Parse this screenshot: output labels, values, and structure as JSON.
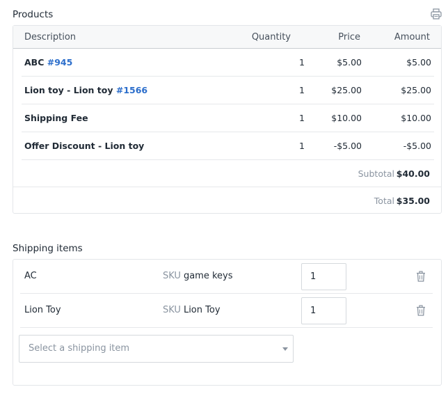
{
  "products": {
    "title": "Products",
    "print_icon": "printer-icon",
    "columns": {
      "description": "Description",
      "quantity": "Quantity",
      "price": "Price",
      "amount": "Amount"
    },
    "rows": [
      {
        "name": "ABC",
        "link": "#945",
        "quantity": "1",
        "price": "$5.00",
        "amount": "$5.00"
      },
      {
        "name": "Lion toy - Lion toy",
        "link": "#1566",
        "quantity": "1",
        "price": "$25.00",
        "amount": "$25.00"
      },
      {
        "name": "Shipping Fee",
        "link": "",
        "quantity": "1",
        "price": "$10.00",
        "amount": "$10.00"
      },
      {
        "name": "Offer Discount - Lion toy",
        "link": "",
        "quantity": "1",
        "price": "-$5.00",
        "amount": "-$5.00"
      }
    ],
    "subtotal": {
      "label": "Subtotal",
      "value": "$40.00"
    },
    "total": {
      "label": "Total",
      "value": "$35.00"
    }
  },
  "shipping": {
    "title": "Shipping items",
    "sku_label": "SKU",
    "items": [
      {
        "name": "AC",
        "sku": "game keys",
        "quantity": "1"
      },
      {
        "name": "Lion Toy",
        "sku": "Lion Toy",
        "quantity": "1"
      }
    ],
    "select_placeholder": "Select a shipping item",
    "trash_icon": "trash-icon"
  },
  "colors": {
    "link": "#2c6ecb",
    "muted": "#8a94a0",
    "text": "#212b36",
    "border": "#e3e6e9",
    "header_bg": "#f7f8f9"
  }
}
